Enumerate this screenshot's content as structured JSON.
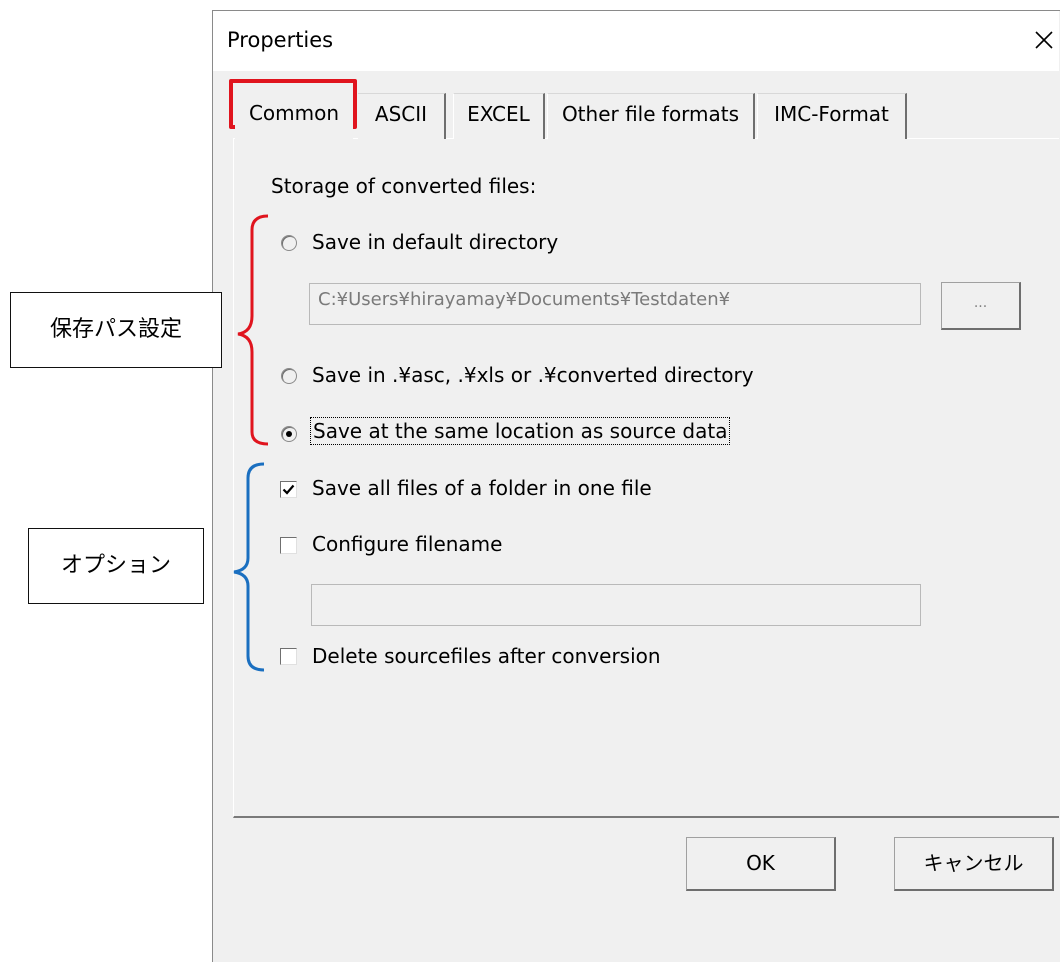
{
  "dialog": {
    "title": "Properties",
    "tabs": [
      {
        "label": "Common",
        "active": true
      },
      {
        "label": "ASCII",
        "active": false
      },
      {
        "label": "EXCEL",
        "active": false
      },
      {
        "label": "Other file formats",
        "active": false
      },
      {
        "label": "IMC-Format",
        "active": false
      }
    ],
    "storage_heading": "Storage of converted files:",
    "radio_options": [
      {
        "label": "Save in default directory",
        "selected": false
      },
      {
        "label": "Save in .¥asc, .¥xls or .¥converted directory",
        "selected": false
      },
      {
        "label": "Save at the same location as source data",
        "selected": true
      }
    ],
    "default_directory_path": "C:¥Users¥hirayamay¥Documents¥Testdaten¥",
    "browse_button_label": "...",
    "checkboxes": [
      {
        "label": "Save all files of a folder in one file",
        "checked": true
      },
      {
        "label": "Configure filename",
        "checked": false
      },
      {
        "label": "Delete sourcefiles after conversion",
        "checked": false
      }
    ],
    "filename_value": "",
    "ok_label": "OK",
    "cancel_label": "キャンセル"
  },
  "annotations": {
    "path_setting_label": "保存パス設定",
    "options_label": "オプション",
    "highlight_color": "#e0141e",
    "path_bracket_color": "#e0141e",
    "options_bracket_color": "#1a6fc0"
  }
}
